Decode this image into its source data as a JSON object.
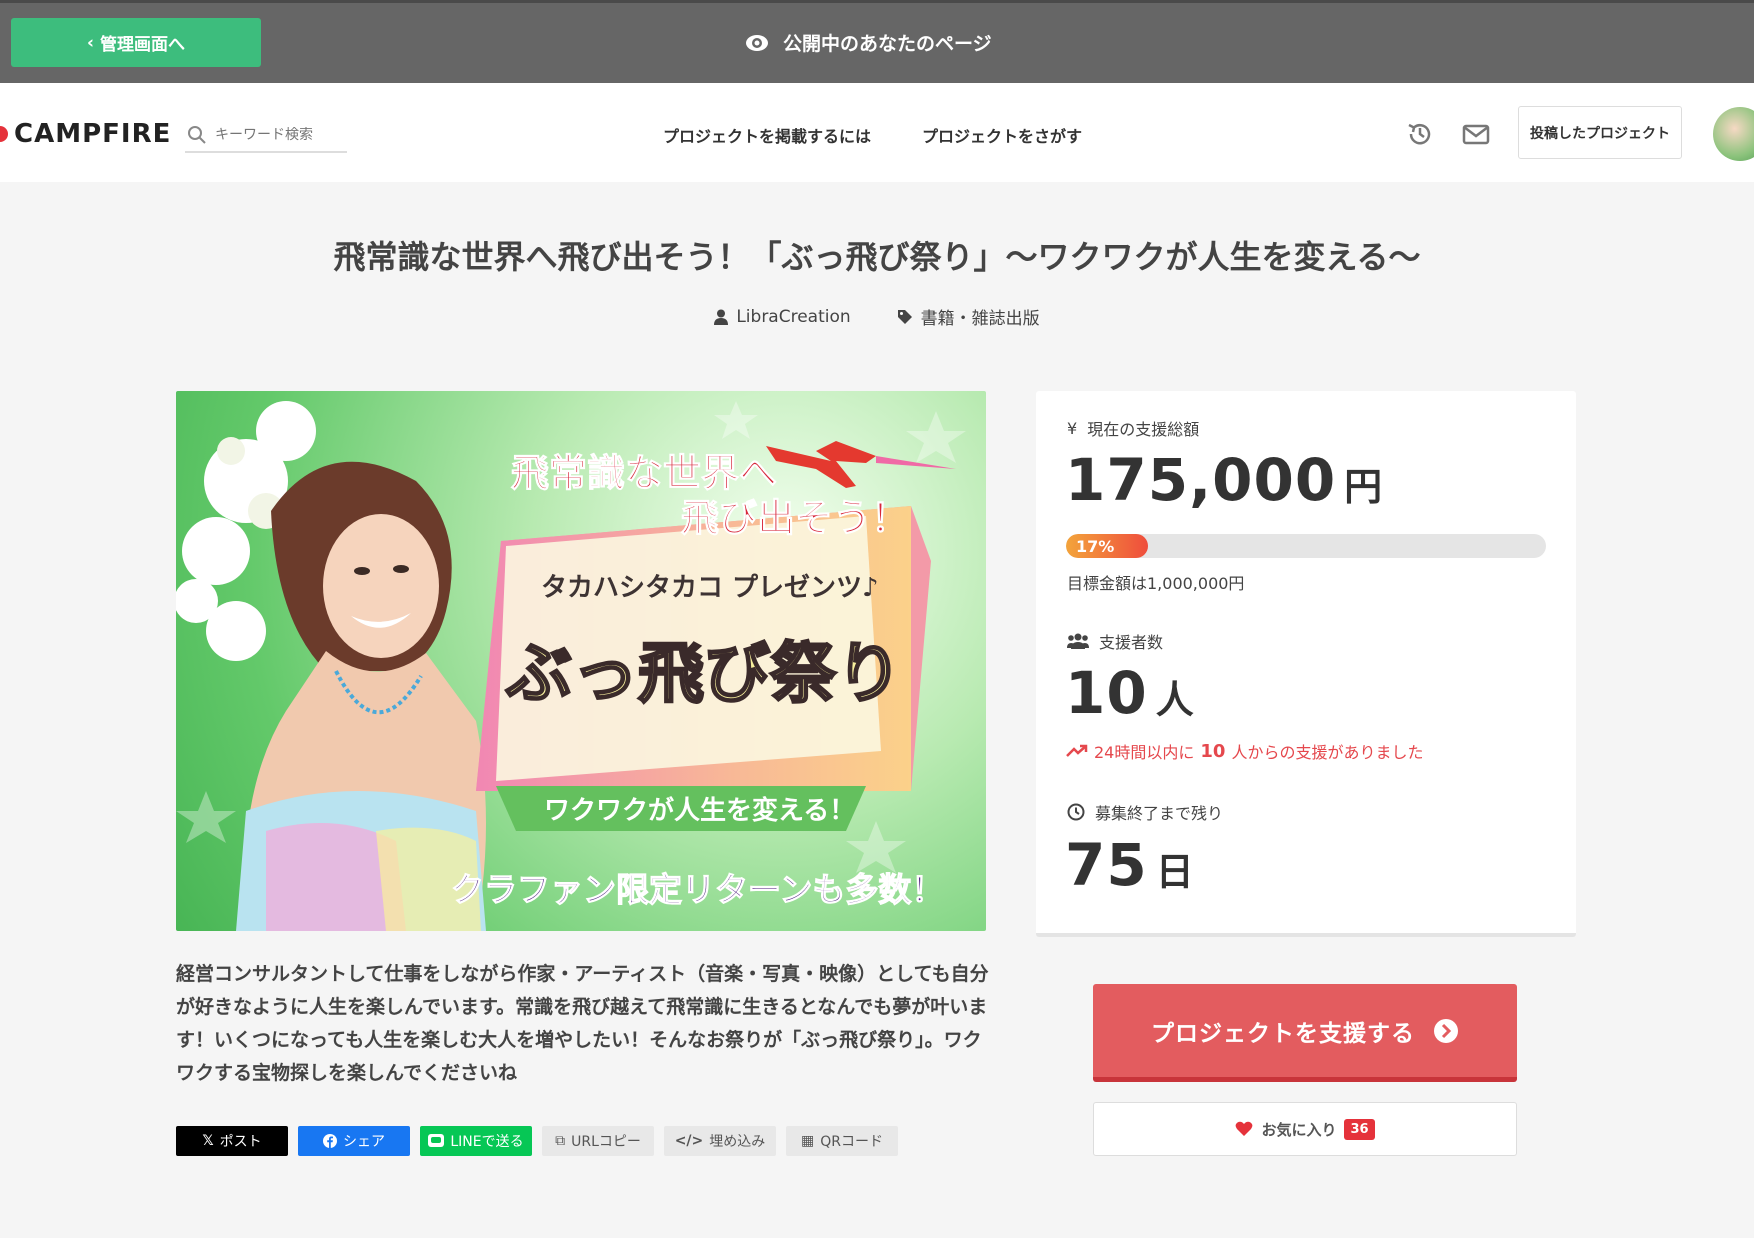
{
  "admin_bar": {
    "back_label": "管理画面へ",
    "public_label": "公開中のあなたのページ"
  },
  "header": {
    "logo_text": "CAMPFIRE",
    "search_placeholder": "キーワード検索",
    "nav_post_label": "プロジェクトを掲載するには",
    "nav_find_label": "プロジェクトをさがす",
    "posted_projects_label": "投稿したプロジェクト"
  },
  "project": {
    "title": "飛常識な世界へ飛び出そう！「ぶっ飛び祭り」〜ワクワクが人生を変える〜",
    "author": "LibraCreation",
    "category": "書籍・雑誌出版",
    "description": "経営コンサルタントして仕事をしながら作家・アーティスト（音楽・写真・映像）としても自分が好きなように人生を楽しんでいます。常識を飛び越えて飛常識に生きるとなんでも夢が叶います！いくつになっても人生を楽しむ大人を増やしたい！そんなお祭りが「ぶっ飛び祭り」。ワクワクする宝物探しを楽しんでくださいね"
  },
  "hero_image": {
    "line1": "飛常識な世界へ",
    "line2": "飛び出そう！",
    "line3": "タカハシタカコ プレゼンツ♪",
    "line4": "ぶっ飛び祭り",
    "line5": "ワクワクが人生を変える！",
    "line6": "クラファン限定リターンも多数！"
  },
  "share": {
    "post": "ポスト",
    "share": "シェア",
    "line": "LINEで送る",
    "url_copy": "URLコピー",
    "embed": "埋め込み",
    "qr": "QRコード"
  },
  "stats": {
    "total_label": "現在の支援総額",
    "total_amount": "175,000",
    "currency_unit": "円",
    "progress_percent": 17,
    "progress_text": "17%",
    "goal_text": "目標金額は1,000,000円",
    "supporters_label": "支援者数",
    "supporters_count": "10",
    "supporters_unit": "人",
    "recent_prefix": "24時間以内に",
    "recent_count": "10",
    "recent_suffix": "人からの支援がありました",
    "remaining_label": "募集終了まで残り",
    "remaining_days": "75",
    "days_unit": "日"
  },
  "actions": {
    "support_label": "プロジェクトを支援する",
    "favorite_label": "お気に入り",
    "favorite_count": "36"
  },
  "colors": {
    "admin_bar": "#666666",
    "admin_back": "#3dbd7d",
    "support_btn": "#e35c5f",
    "accent_red": "#e5323b"
  }
}
